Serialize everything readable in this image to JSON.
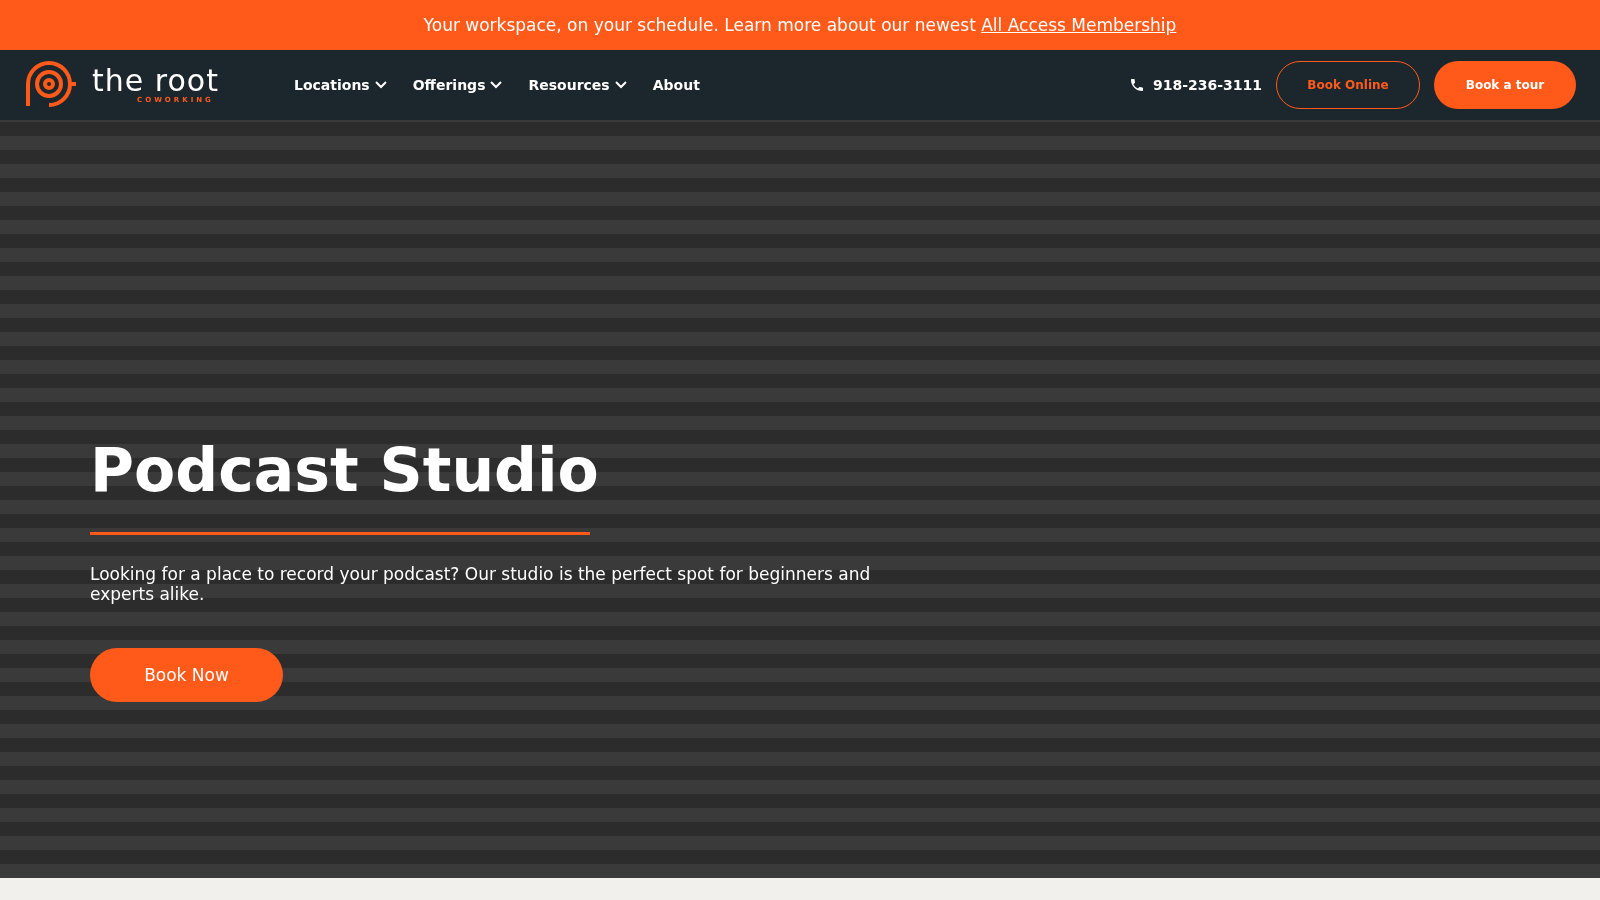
{
  "announcement": {
    "text": "Your workspace, on your schedule. Learn more about our newest",
    "link": "All Access Membership"
  },
  "logo": {
    "name": "the root",
    "tagline": "COWORKING"
  },
  "nav": [
    {
      "label": "Locations",
      "dropdown": true
    },
    {
      "label": "Offerings",
      "dropdown": true
    },
    {
      "label": "Resources",
      "dropdown": true
    },
    {
      "label": "About",
      "dropdown": false
    }
  ],
  "phone": "918-236-3111",
  "buttons": [
    {
      "label": "Book Online",
      "kind": "outline"
    },
    {
      "label": "Book a tour",
      "kind": "filled"
    }
  ],
  "hero": {
    "title": "Podcast Studio",
    "text": "Looking for a place to record your podcast? Our studio is the perfect spot for beginners and experts alike.",
    "button": "Book Now"
  }
}
